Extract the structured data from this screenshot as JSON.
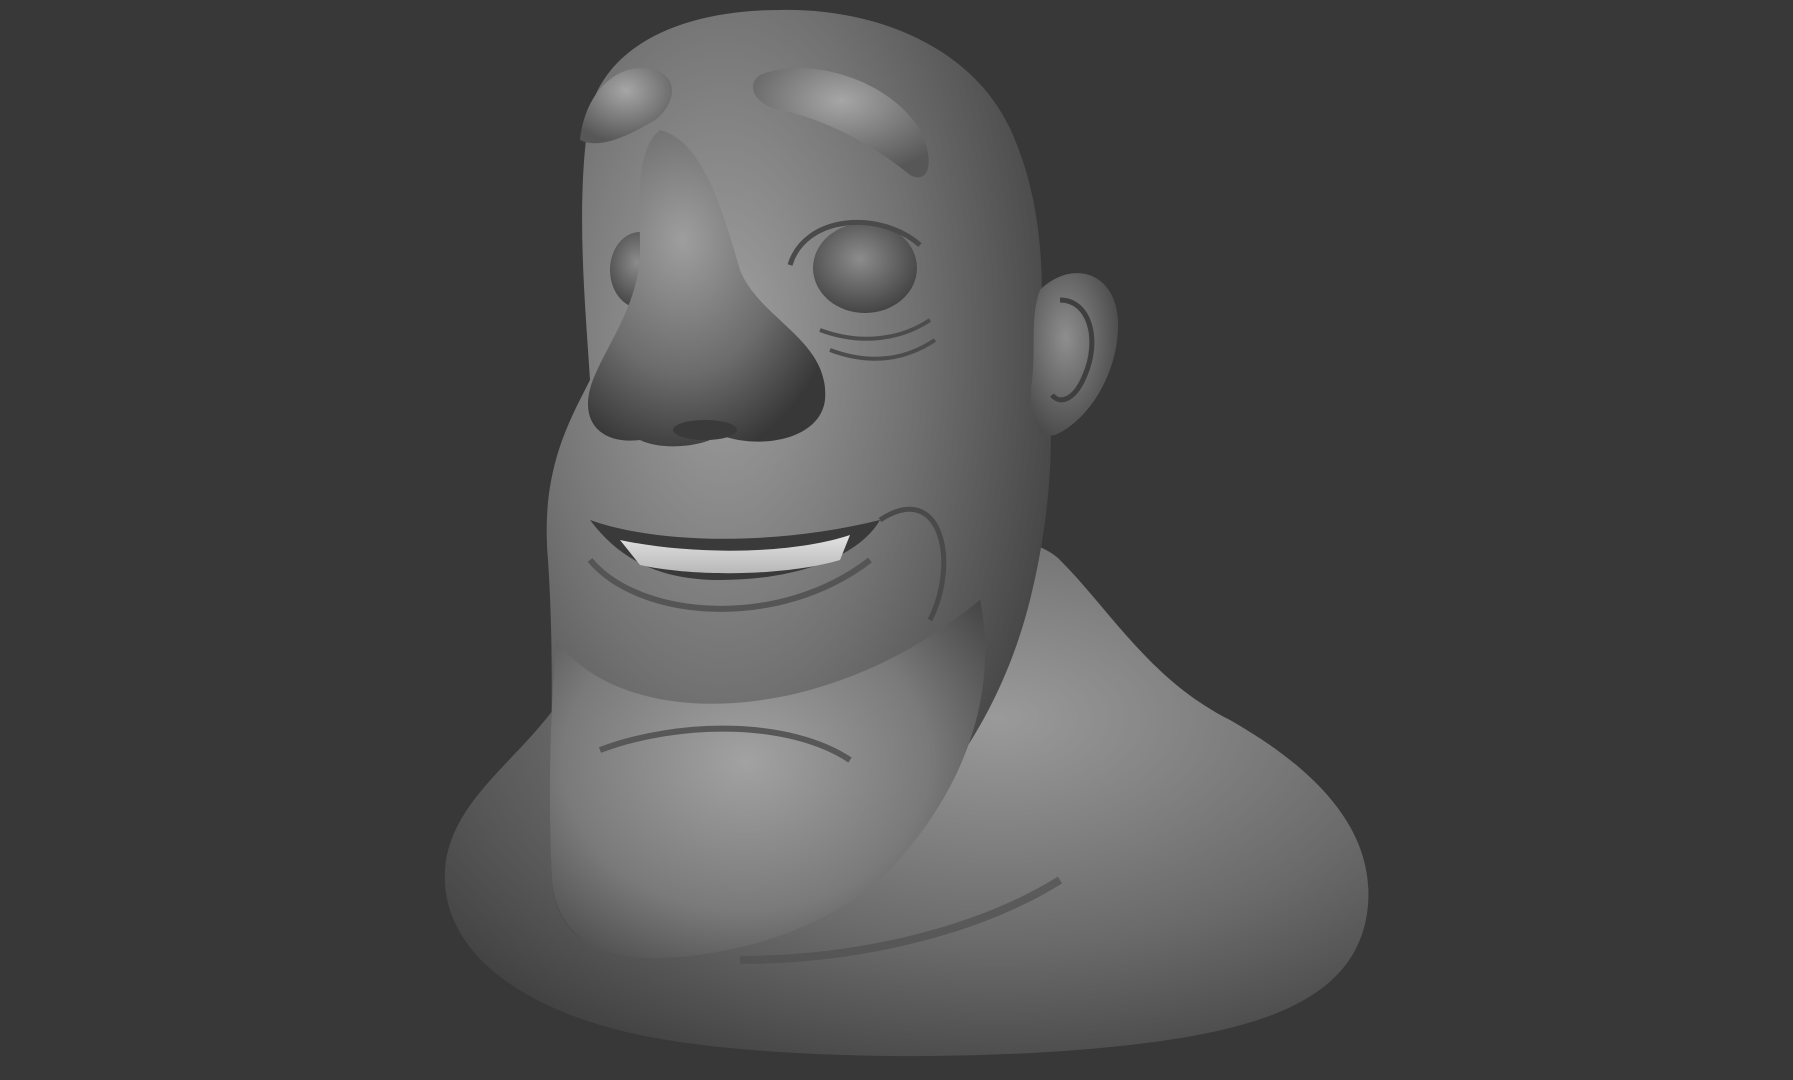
{
  "viewport": {
    "background_color": "#383838",
    "model_base_color": "#6f6f6f",
    "model_highlight_color": "#a8a8a8",
    "model_shadow_color": "#2a2a2a",
    "teeth_color": "#d8d8d8"
  },
  "model": {
    "type": "sculpted-bust",
    "material": "matte-gray-clay",
    "expression": "wide-grin"
  }
}
